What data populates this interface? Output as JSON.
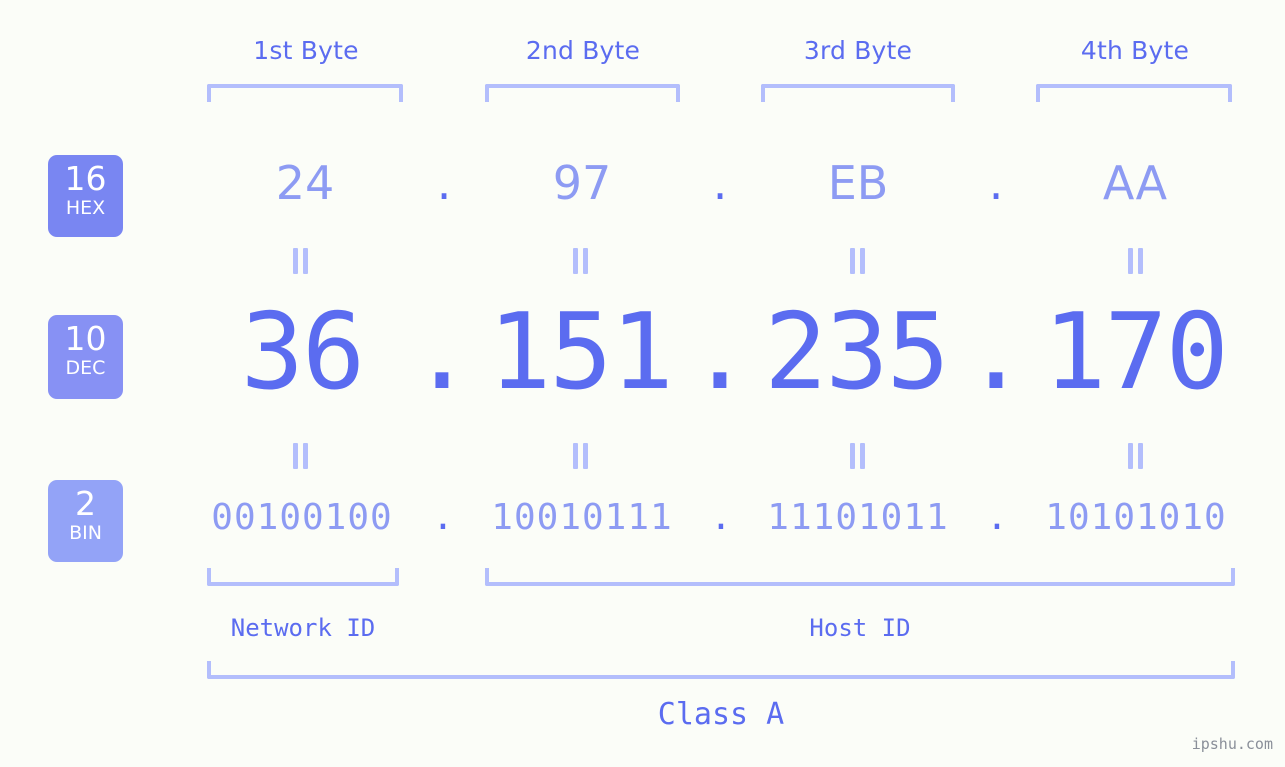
{
  "meta": {
    "background_color": "#fbfdf8",
    "accent_strong": "#5b6cf0",
    "accent_light": "#8d9bf3",
    "bracket_color": "#b3befc",
    "watermark": "ipshu.com"
  },
  "byte_headers": [
    {
      "label": "1st Byte"
    },
    {
      "label": "2nd Byte"
    },
    {
      "label": "3rd Byte"
    },
    {
      "label": "4th Byte"
    }
  ],
  "bases": [
    {
      "num": "16",
      "label": "HEX",
      "color": "#7986f2"
    },
    {
      "num": "10",
      "label": "DEC",
      "color": "#8791f4"
    },
    {
      "num": "2",
      "label": "BIN",
      "color": "#93a3f7"
    }
  ],
  "rows": {
    "hex": {
      "base": "16",
      "name": "HEX",
      "octets": [
        "24",
        "97",
        "EB",
        "AA"
      ],
      "separator": "."
    },
    "dec": {
      "base": "10",
      "name": "DEC",
      "octets": [
        "36",
        "151",
        "235",
        "170"
      ],
      "separator": "."
    },
    "bin": {
      "base": "2",
      "name": "BIN",
      "octets": [
        "00100100",
        "10010111",
        "11101011",
        "10101010"
      ],
      "separator": "."
    }
  },
  "equals_symbol": "=",
  "segments": {
    "network": {
      "label": "Network ID"
    },
    "host": {
      "label": "Host ID"
    },
    "class": {
      "label": "Class A"
    }
  },
  "ip_address": {
    "hex": "24.97.EB.AA",
    "dec": "36.151.235.170",
    "bin": "00100100.10010111.11101011.10101010"
  }
}
